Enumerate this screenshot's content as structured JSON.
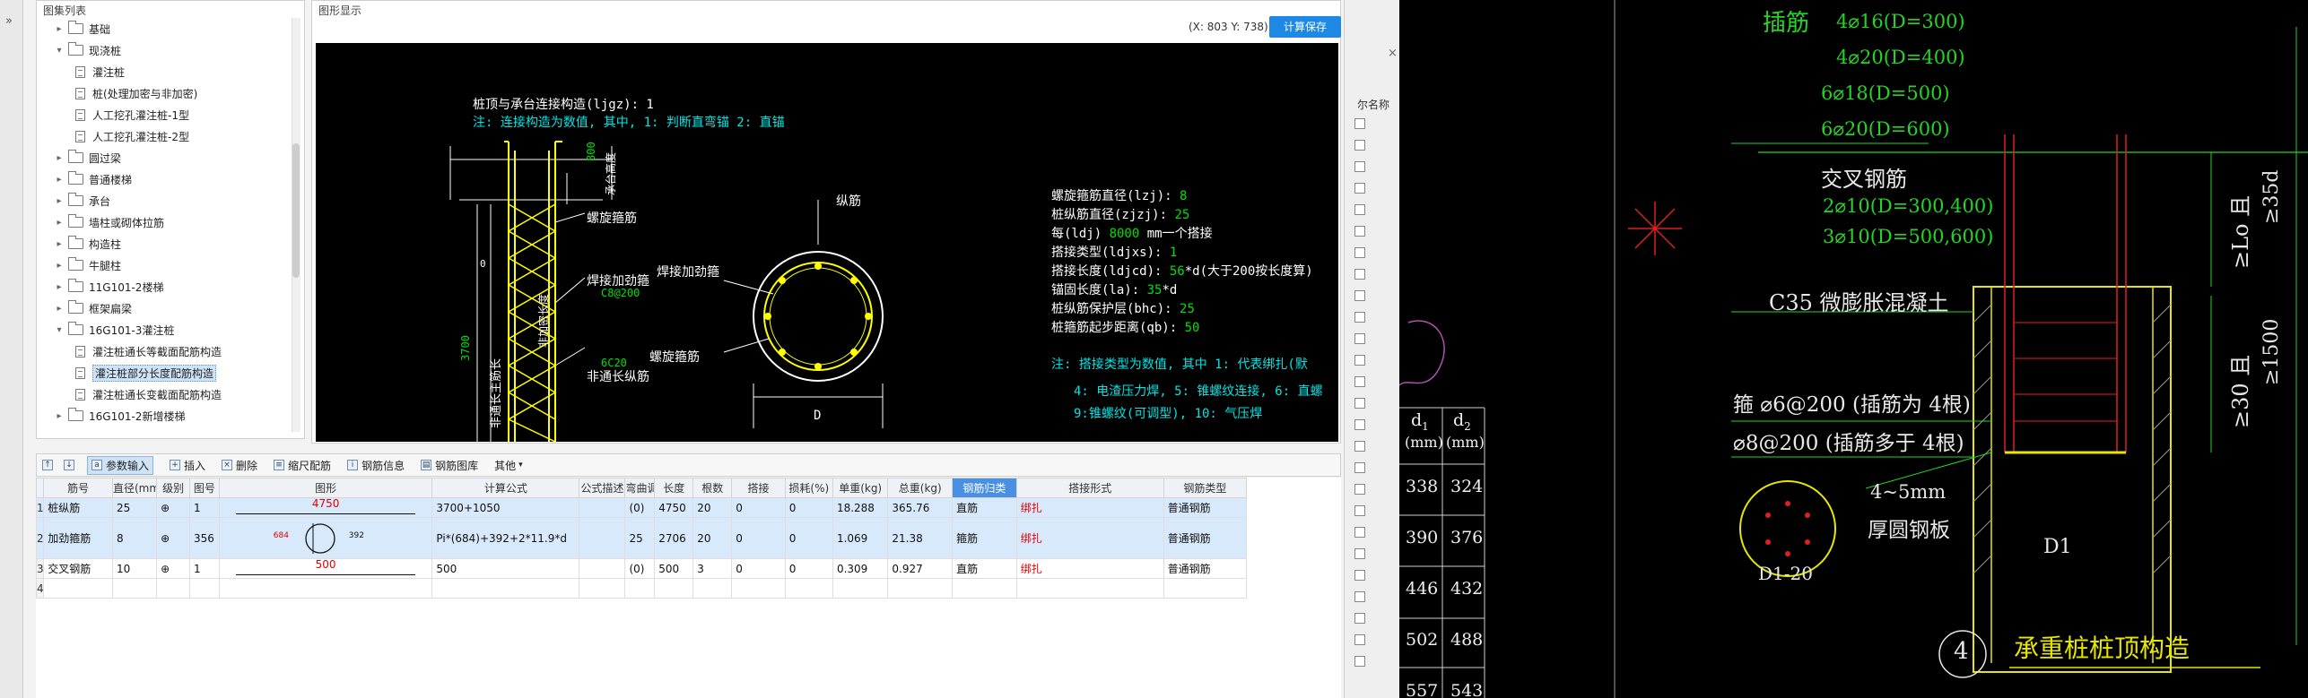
{
  "tree": {
    "title": "图集列表",
    "items": [
      {
        "label": "基础",
        "type": "folder",
        "expanded": false,
        "level": 0
      },
      {
        "label": "现浇桩",
        "type": "folder",
        "expanded": true,
        "level": 0
      },
      {
        "label": "灌注桩",
        "type": "doc",
        "level": 1
      },
      {
        "label": "桩(处理加密与非加密)",
        "type": "doc",
        "level": 1
      },
      {
        "label": "人工挖孔灌注桩-1型",
        "type": "doc",
        "level": 1
      },
      {
        "label": "人工挖孔灌注桩-2型",
        "type": "doc",
        "level": 1
      },
      {
        "label": "圆过梁",
        "type": "folder",
        "expanded": false,
        "level": 0
      },
      {
        "label": "普通楼梯",
        "type": "folder",
        "expanded": false,
        "level": 0
      },
      {
        "label": "承台",
        "type": "folder",
        "expanded": false,
        "level": 0
      },
      {
        "label": "墙柱或砌体拉筋",
        "type": "folder",
        "expanded": false,
        "level": 0
      },
      {
        "label": "构造柱",
        "type": "folder",
        "expanded": false,
        "level": 0
      },
      {
        "label": "牛腿柱",
        "type": "folder",
        "expanded": false,
        "level": 0
      },
      {
        "label": "11G101-2楼梯",
        "type": "folder",
        "expanded": false,
        "level": 0
      },
      {
        "label": "框架扁梁",
        "type": "folder",
        "expanded": false,
        "level": 0
      },
      {
        "label": "16G101-3灌注桩",
        "type": "folder",
        "expanded": true,
        "level": 0
      },
      {
        "label": "灌注桩通长等截面配筋构造",
        "type": "doc",
        "level": 1
      },
      {
        "label": "灌注桩部分长度配筋构造",
        "type": "doc",
        "level": 1,
        "selected": true
      },
      {
        "label": "灌注桩通长变截面配筋构造",
        "type": "doc",
        "level": 1
      },
      {
        "label": "16G101-2新增楼梯",
        "type": "folder",
        "expanded": false,
        "level": 0
      }
    ]
  },
  "figure": {
    "title": "图形显示",
    "coords": "(X: 803 Y: 738)",
    "save_label": "计算保存",
    "canvas": {
      "heading1": "桩顶与承台连接构造(ljgz): 1",
      "heading2": "注: 连接构造为数值, 其中, 1: 判断直弯锚     2: 直锚",
      "label_800": "800",
      "label_chengtai": "承台高度",
      "label_jiami": "非加密长度",
      "label_0": "0",
      "label_3700": "3700",
      "label_feitong": "非通长主筋长",
      "label_luoxuan": "螺旋箍筋",
      "label_hanjie": "焊接加劲箍",
      "label_c8": "C8@200",
      "label_6c20": "6C20",
      "label_feitongzong": "非通长纵筋",
      "label_zongjin": "纵筋",
      "label_hanjie2": "焊接加劲箍",
      "label_luoxuan2": "螺旋箍筋",
      "label_d": "D",
      "params": [
        {
          "text": "螺旋箍筋直径(lzj): ",
          "val": "8"
        },
        {
          "text": "桩纵筋直径(zjzj): ",
          "val": "25"
        },
        {
          "text": "每(ldj) ",
          "val": "8000",
          "suffix": " mm一个搭接"
        },
        {
          "text": "搭接类型(ldjxs): ",
          "val": "1"
        },
        {
          "text": "搭接长度(ldjcd): ",
          "val": "56",
          "suffix": "*d(大于200按长度算)"
        },
        {
          "text": "锚固长度(la): ",
          "val": "35",
          "suffix": "*d"
        },
        {
          "text": "桩纵筋保护层(bhc): ",
          "val": "25"
        },
        {
          "text": "桩箍筋起步距离(qb): ",
          "val": "50"
        }
      ],
      "note1": "注: 搭接类型为数值, 其中 1: 代表绑扎(默",
      "note2": "4: 电渣压力焊, 5: 锥螺纹连接, 6: 直螺",
      "note3": "9:锥螺纹(可调型), 10: 气压焊"
    }
  },
  "toolbar": {
    "items": [
      "参数输入",
      "插入",
      "删除",
      "缩尺配筋",
      "钢筋信息",
      "钢筋图库",
      "其他"
    ]
  },
  "grid": {
    "headers": [
      "筋号",
      "直径(mm)",
      "级别",
      "图号",
      "图形",
      "计算公式",
      "公式描述",
      "弯曲调整",
      "长度",
      "根数",
      "搭接",
      "损耗(%)",
      "单重(kg)",
      "总重(kg)",
      "钢筋归类",
      "搭接形式",
      "钢筋类型"
    ],
    "rows": [
      {
        "num": "1",
        "name": "桩纵筋",
        "dia": "25",
        "grade": "⊕",
        "fig": "1",
        "shape": "4750",
        "formula": "3700+1050",
        "desc": "",
        "bend": "(0)",
        "len": "4750",
        "count": "20",
        "lap": "0",
        "loss": "0",
        "unit": "18.288",
        "total": "365.76",
        "cat": "直筋",
        "lapform": "绑扎",
        "type": "普通钢筋"
      },
      {
        "num": "2",
        "name": "加劲箍筋",
        "dia": "8",
        "grade": "⊕",
        "fig": "356",
        "shape_a": "684",
        "shape_b": "392",
        "formula": "Pi*(684)+392+2*11.9*d",
        "desc": "",
        "bend": "25",
        "len": "2706",
        "count": "20",
        "lap": "0",
        "loss": "0",
        "unit": "1.069",
        "total": "21.38",
        "cat": "箍筋",
        "lapform": "绑扎",
        "type": "普通钢筋"
      },
      {
        "num": "3",
        "name": "交叉钢筋",
        "dia": "10",
        "grade": "⊕",
        "fig": "1",
        "shape": "500",
        "formula": "500",
        "desc": "",
        "bend": "(0)",
        "len": "500",
        "count": "3",
        "lap": "0",
        "loss": "0",
        "unit": "0.309",
        "total": "0.927",
        "cat": "直筋",
        "lapform": "绑扎",
        "type": "普通钢筋"
      },
      {
        "num": "4"
      }
    ]
  },
  "rightstrip": {
    "label": "尔名称"
  },
  "drawing": {
    "chajin": "插筋",
    "bars": [
      "4⌀16(D=300)",
      "4⌀20(D=400)",
      "6⌀18(D=500)",
      "6⌀20(D=600)"
    ],
    "jiaocha": "交叉钢筋",
    "jiaocha_bars": [
      "2⌀10(D=300,400)",
      "3⌀10(D=500,600)"
    ],
    "c35": "C35 微膨胀混凝土",
    "gu1": "箍 ⌀6@200  (插筋为 4根)",
    "gu2": "⌀8@200  (插筋多于 4根)",
    "plate1": "4~5mm",
    "plate2": "厚圆钢板",
    "d1": "D1",
    "d120": "D1-20",
    "dim_lo": "≥Lo 且",
    "dim_35d": "≥35d",
    "dim_30": "≥30 且",
    "dim_1500": "≥1500",
    "num4": "4",
    "title": "承重桩桩顶构造",
    "table_h1": "d",
    "table_h1_sub": "1",
    "table_h2": "d",
    "table_h2_sub": "2",
    "table_unit": "(mm)",
    "table_rows": [
      [
        "338",
        "324"
      ],
      [
        "390",
        "376"
      ],
      [
        "446",
        "432"
      ],
      [
        "502",
        "488"
      ],
      [
        "557",
        "543"
      ]
    ]
  }
}
